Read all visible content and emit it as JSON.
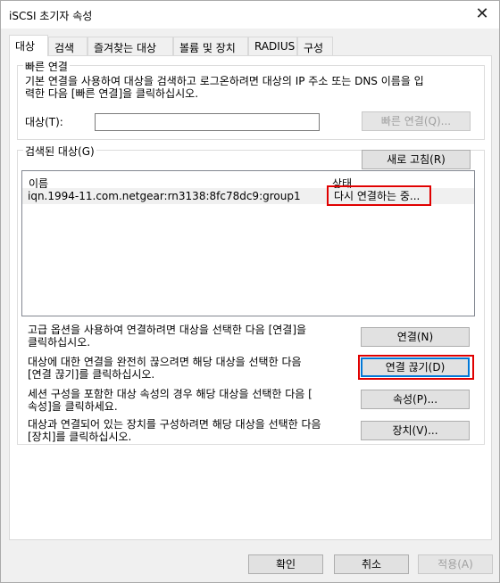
{
  "window": {
    "title": "iSCSI 초기자 속성",
    "close_glyph": "✕"
  },
  "tabs": [
    "대상",
    "검색",
    "즐겨찾는 대상",
    "볼륨 및 장치",
    "RADIUS",
    "구성"
  ],
  "quick_connect": {
    "group_label": "빠른 연결",
    "description_line1": "기본 연결을 사용하여 대상을 검색하고 로그온하려면 대상의 IP 주소 또는 DNS 이름을 입",
    "description_line2": "력한 다음 [빠른 연결]을 클릭하십시오.",
    "target_label": "대상(T):",
    "target_value": "",
    "button": "빠른 연결(Q)..."
  },
  "discovered": {
    "group_label": "검색된 대상(G)",
    "refresh_button": "새로 고침(R)",
    "columns": {
      "name": "이름",
      "status": "상태"
    },
    "rows": [
      {
        "name": "iqn.1994-11.com.netgear:rn3138:8fc78dc9:group1",
        "status": "다시 연결하는 중..."
      }
    ]
  },
  "actions": [
    {
      "line1": "고급 옵션을 사용하여 연결하려면 대상을 선택한 다음 [연결]을",
      "line2": "클릭하십시오.",
      "button": "연결(N)"
    },
    {
      "line1": "대상에 대한 연결을 완전히 끊으려면 해당 대상을 선택한 다음",
      "line2": "[연결 끊기]를 클릭하십시오.",
      "button": "연결 끊기(D)"
    },
    {
      "line1": "세션 구성을 포함한 대상 속성의 경우 해당 대상을 선택한 다음 [",
      "line2": "속성]을 클릭하세요.",
      "button": "속성(P)..."
    },
    {
      "line1": "대상과 연결되어 있는 장치를 구성하려면 해당 대상을 선택한 다음",
      "line2": "[장치]를 클릭하십시오.",
      "button": "장치(V)..."
    }
  ],
  "footer": {
    "ok": "확인",
    "cancel": "취소",
    "apply": "적용(A)"
  },
  "colors": {
    "highlight_red": "#e00000",
    "focus_blue": "#0078d7"
  }
}
